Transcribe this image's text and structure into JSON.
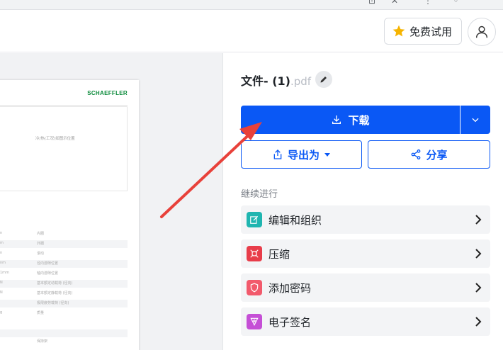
{
  "topbar": {
    "trial_label": "免费试用",
    "trial_icon": "star-icon",
    "avatar_icon": "user-icon"
  },
  "preview": {
    "brand": "SCHAEFFLER",
    "box_text": "冷/热(工况)如图示位置",
    "rows": [
      {
        "c1": "n",
        "c2": "内圈"
      },
      {
        "c1": "m",
        "c2": "外圈"
      },
      {
        "c1": "n",
        "c2": "滚动"
      },
      {
        "c1": "nm",
        "c2": "径向游隙位置"
      },
      {
        "c1": "1mm",
        "c2": "轴向游隙位置"
      },
      {
        "c1": "N",
        "c2": "基本额定动载荷 (径向)"
      },
      {
        "c1": "N",
        "c2": "基本额定静载荷 (径向)"
      },
      {
        "c1": "",
        "c2": "极限疲劳载荷 (径向)"
      },
      {
        "c1": "g",
        "c2": "质量"
      },
      {
        "c1": "",
        "c2": ""
      },
      {
        "c1": "",
        "c2": "保持架"
      }
    ]
  },
  "panel": {
    "file_name": "文件- (1)",
    "file_ext": ".pdf",
    "download_label": "下载",
    "export_label": "导出为",
    "share_label": "分享",
    "continue_label": "继续进行",
    "actions": [
      {
        "label": "编辑和组织",
        "color": "#1fb5b0"
      },
      {
        "label": "压缩",
        "color": "#e83d4a"
      },
      {
        "label": "添加密码",
        "color": "#f25a6c"
      },
      {
        "label": "电子签名",
        "color": "#c54fd6"
      }
    ]
  },
  "colors": {
    "accent": "#0a58f5",
    "annotation": "#e8413a"
  }
}
